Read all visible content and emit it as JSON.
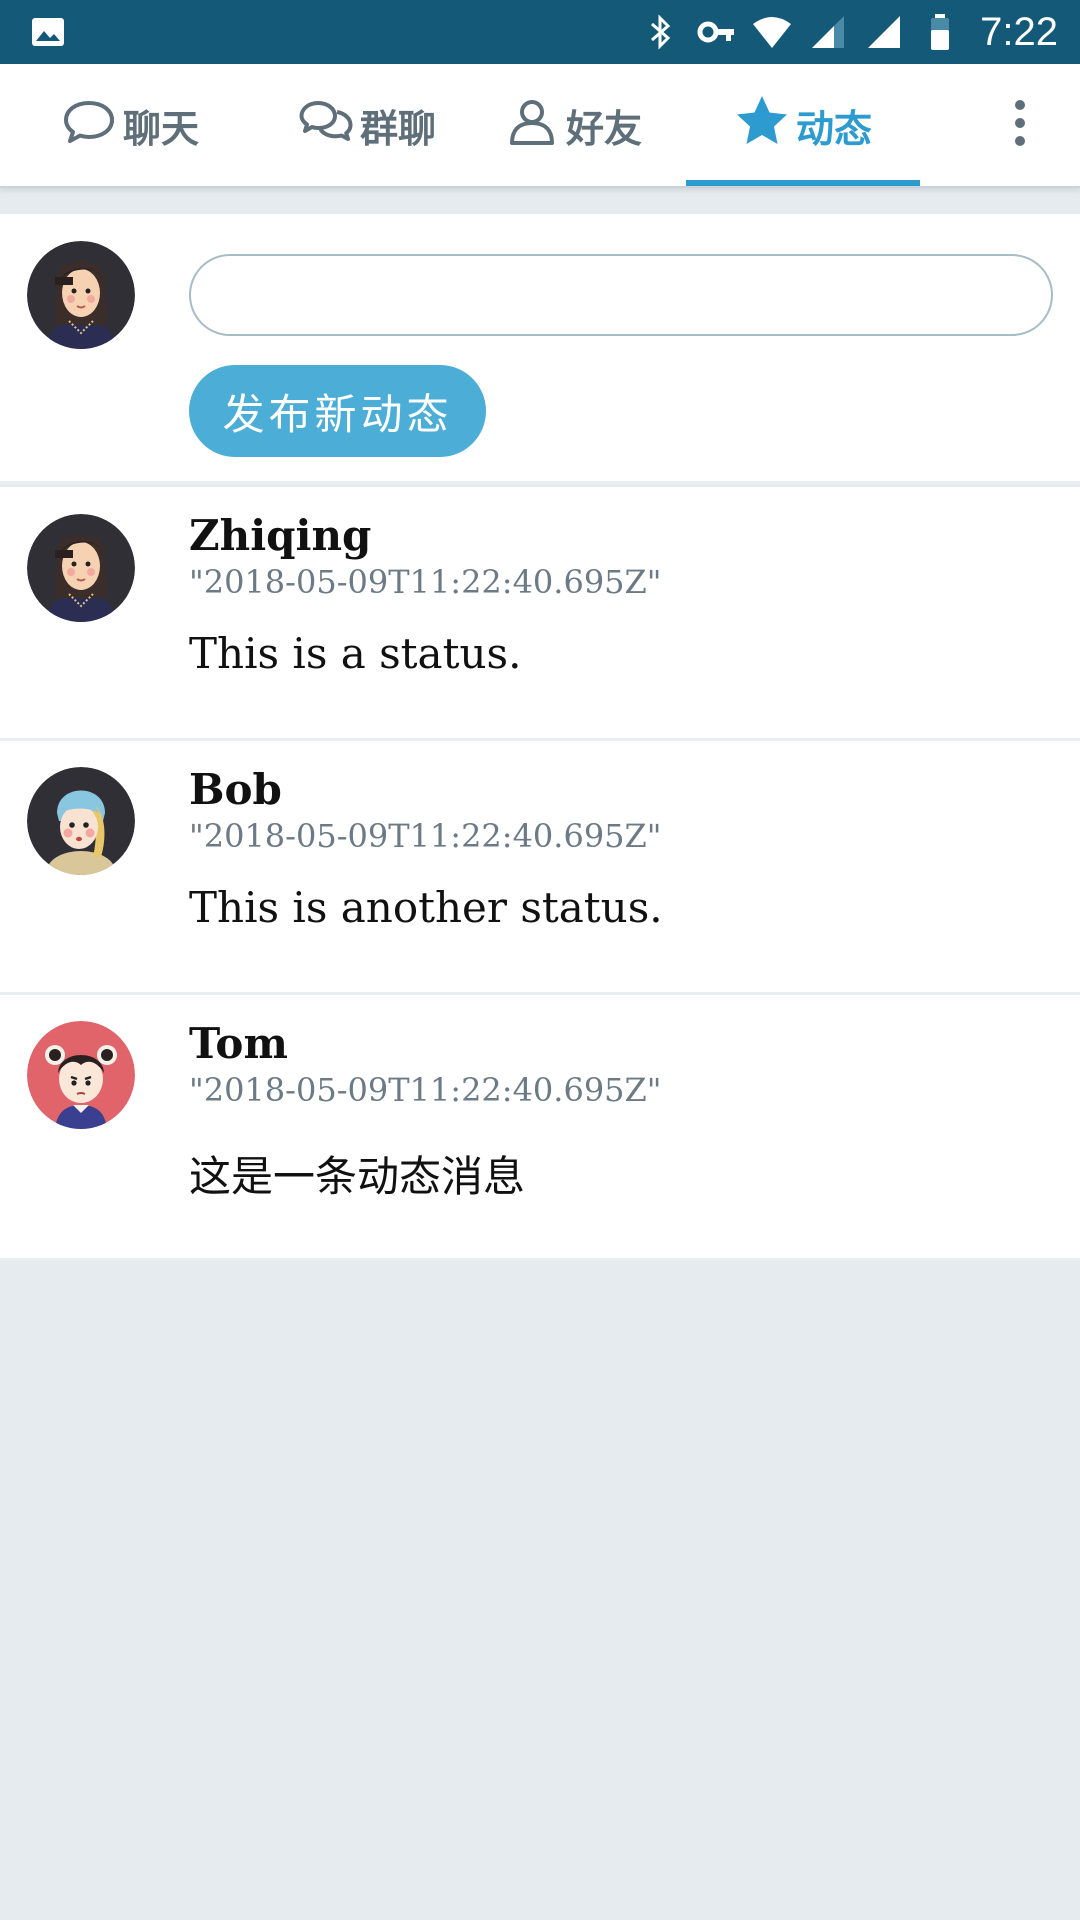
{
  "status_bar": {
    "time": "7:22",
    "icons": [
      "image-icon",
      "bluetooth-icon",
      "vpn-key-icon",
      "wifi-icon",
      "cellular-signal-icon",
      "cellular-signal-icon",
      "battery-icon"
    ]
  },
  "tabs": [
    {
      "label": "聊天",
      "icon": "chat-bubble-icon",
      "active": false
    },
    {
      "label": "群聊",
      "icon": "group-chat-icon",
      "active": false
    },
    {
      "label": "好友",
      "icon": "person-icon",
      "active": false
    },
    {
      "label": "动态",
      "icon": "star-icon",
      "active": true
    }
  ],
  "menu_icon": "more-vertical-icon",
  "accent_color": "#2d9bd0",
  "composer": {
    "input_value": "",
    "placeholder": "",
    "button_label": "发布新动态"
  },
  "feed": [
    {
      "author": "Zhiqing",
      "timestamp": "\"2018-05-09T11:22:40.695Z\"",
      "content": "This is a status."
    },
    {
      "author": "Bob",
      "timestamp": "\"2018-05-09T11:22:40.695Z\"",
      "content": "This is another status."
    },
    {
      "author": "Tom",
      "timestamp": "\"2018-05-09T11:22:40.695Z\"",
      "content": "这是一条动态消息"
    }
  ]
}
